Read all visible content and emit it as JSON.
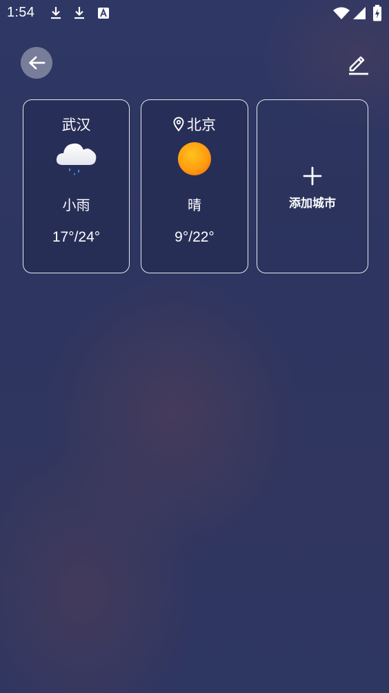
{
  "status_bar": {
    "time": "1:54",
    "left_icons": [
      "download-icon",
      "download-icon",
      "translate-app-icon"
    ],
    "right_icons": [
      "wifi-icon",
      "cell-signal-icon",
      "battery-charging-icon"
    ]
  },
  "toolbar": {
    "back_icon": "arrow-left-icon",
    "edit_icon": "pencil-icon"
  },
  "cities": [
    {
      "name": "武汉",
      "located": false,
      "icon": "light-rain-icon",
      "condition": "小雨",
      "temp_range": "17°/24°"
    },
    {
      "name": "北京",
      "located": true,
      "icon": "sunny-icon",
      "condition": "晴",
      "temp_range": "9°/22°"
    }
  ],
  "add_card": {
    "icon": "plus-icon",
    "label": "添加城市"
  },
  "colors": {
    "background": "#2f3864",
    "card_border": "#ffffff",
    "sun": "#ff9a10",
    "rain": "#3aa0ff",
    "back_button_bg": "#8a8ca6"
  }
}
